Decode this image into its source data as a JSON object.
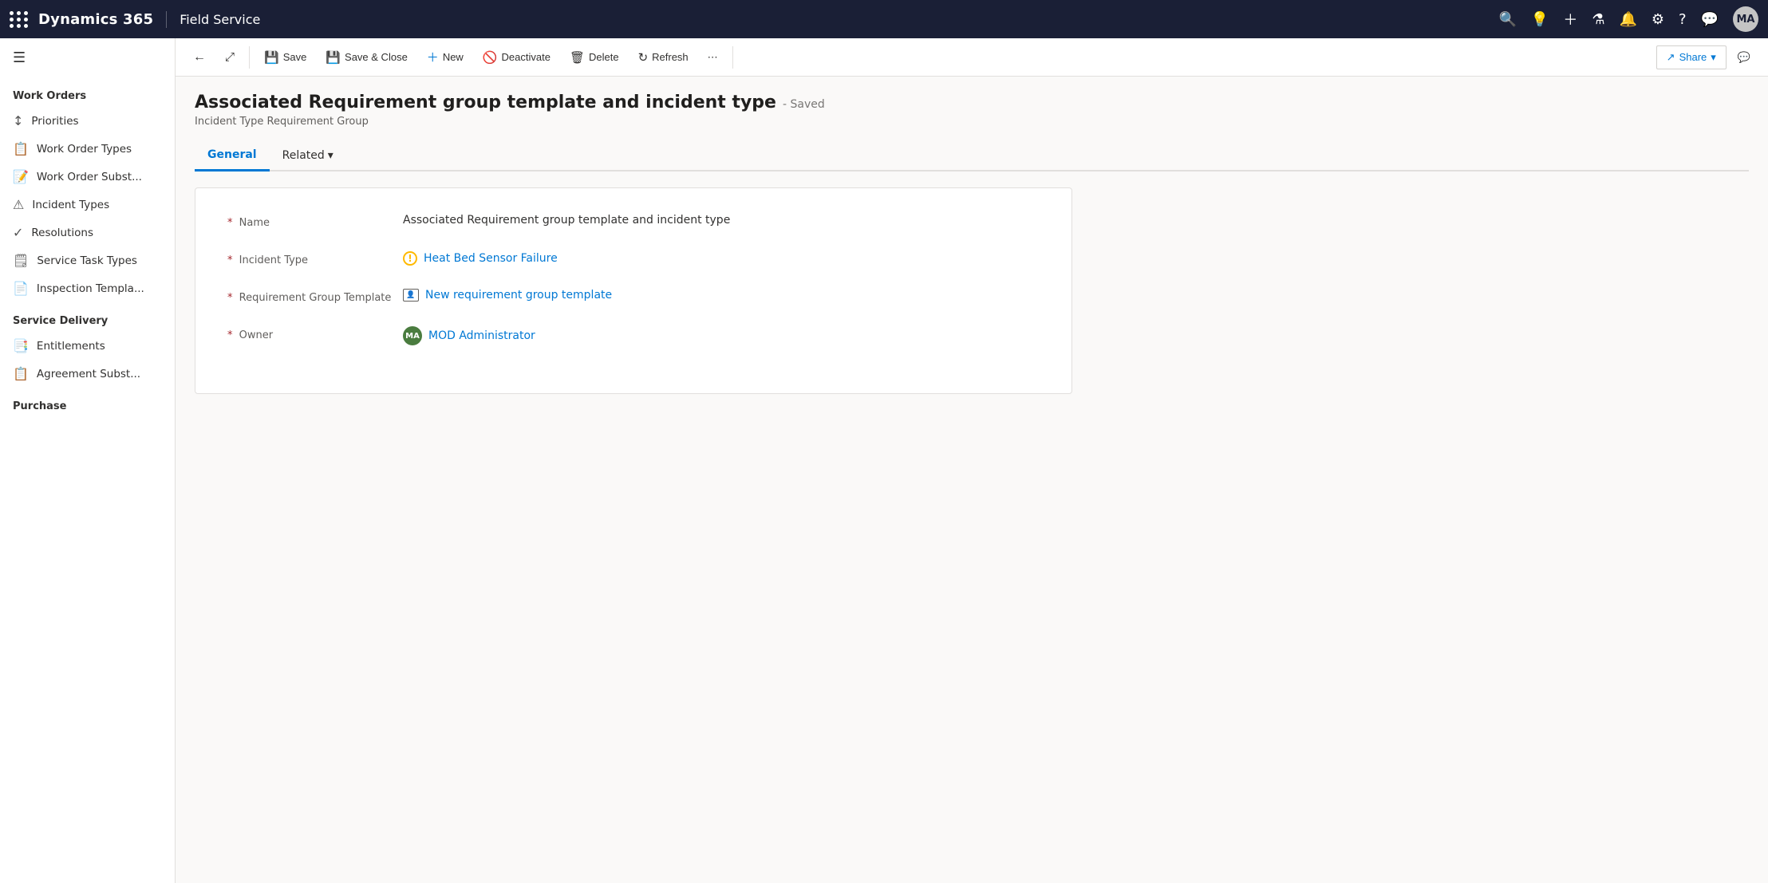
{
  "app": {
    "name": "Dynamics 365",
    "module": "Field Service"
  },
  "nav_icons": [
    "search",
    "lightbulb",
    "plus",
    "filter",
    "bell",
    "gear",
    "help",
    "chat"
  ],
  "user_avatar": "MA",
  "toolbar": {
    "back_label": "←",
    "popout_label": "⤢",
    "save_label": "Save",
    "save_close_label": "Save & Close",
    "new_label": "New",
    "deactivate_label": "Deactivate",
    "delete_label": "Delete",
    "refresh_label": "Refresh",
    "more_label": "⋯",
    "share_label": "Share",
    "chat_icon": "💬"
  },
  "page": {
    "title": "Associated Requirement group template and incident type",
    "status": "- Saved",
    "subtitle": "Incident Type Requirement Group",
    "tabs": [
      {
        "label": "General",
        "active": true
      },
      {
        "label": "Related",
        "active": false
      }
    ]
  },
  "form": {
    "fields": [
      {
        "label": "Name",
        "required": true,
        "value": "Associated Requirement group template and incident type",
        "type": "text"
      },
      {
        "label": "Incident Type",
        "required": true,
        "value": "Heat Bed Sensor Failure",
        "type": "link",
        "icon": "warning"
      },
      {
        "label": "Requirement Group Template",
        "required": true,
        "value": "New requirement group template",
        "type": "link",
        "icon": "group"
      },
      {
        "label": "Owner",
        "required": true,
        "value": "MOD Administrator",
        "type": "owner",
        "avatar": "MA"
      }
    ]
  },
  "sidebar": {
    "sections": [
      {
        "label": "Work Orders",
        "items": [
          {
            "label": "Priorities",
            "icon": "↕"
          },
          {
            "label": "Work Order Types",
            "icon": "📋"
          },
          {
            "label": "Work Order Subst...",
            "icon": "📝"
          },
          {
            "label": "Incident Types",
            "icon": "⚠"
          },
          {
            "label": "Resolutions",
            "icon": "✓"
          },
          {
            "label": "Service Task Types",
            "icon": "🗒"
          },
          {
            "label": "Inspection Templa...",
            "icon": "📄"
          }
        ]
      },
      {
        "label": "Service Delivery",
        "items": [
          {
            "label": "Entitlements",
            "icon": "📑"
          },
          {
            "label": "Agreement Subst...",
            "icon": "📋"
          }
        ]
      },
      {
        "label": "Purchase",
        "items": []
      }
    ]
  }
}
